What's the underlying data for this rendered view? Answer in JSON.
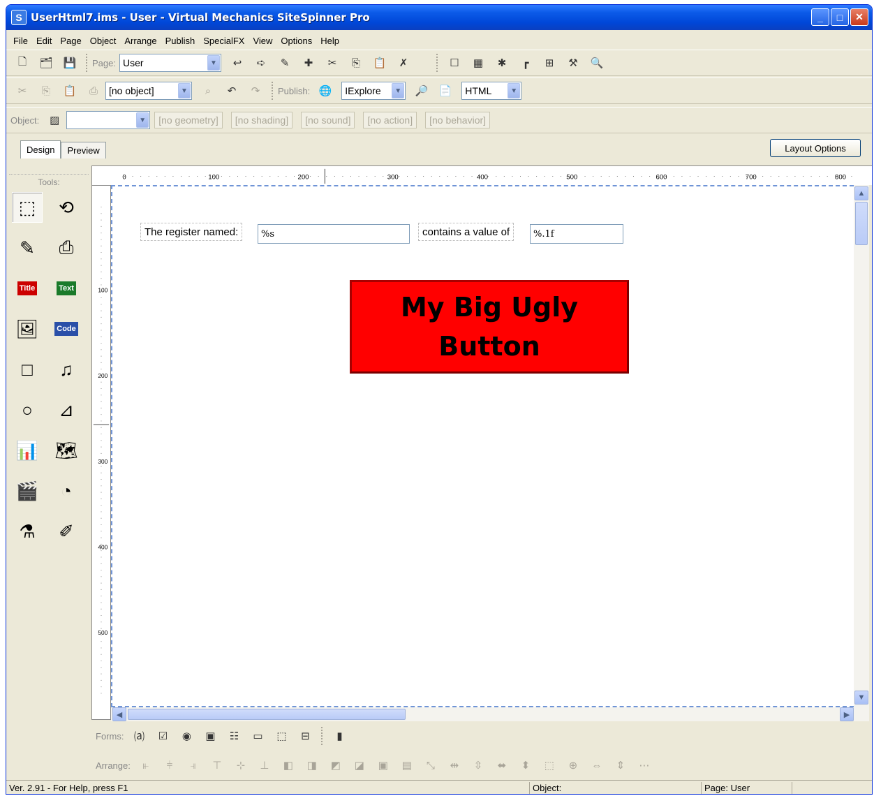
{
  "window": {
    "title": "UserHtml7.ims - User - Virtual Mechanics SiteSpinner Pro"
  },
  "menu": [
    "File",
    "Edit",
    "Page",
    "Object",
    "Arrange",
    "Publish",
    "SpecialFX",
    "View",
    "Options",
    "Help"
  ],
  "toolbar1": {
    "page_label": "Page:",
    "page_value": "User"
  },
  "toolbar2": {
    "object_combo": "[no object]",
    "publish_label": "Publish:",
    "browser": "IExplore",
    "format": "HTML"
  },
  "toolbar3": {
    "object_label": "Object:",
    "object_value": "",
    "fields": [
      "[no geometry]",
      "[no shading]",
      "[no sound]",
      "[no action]",
      "[no behavior]"
    ]
  },
  "tabs": {
    "design": "Design",
    "preview": "Preview"
  },
  "layout_options": "Layout Options",
  "tools_label": "Tools:",
  "ruler": {
    "top": [
      "0",
      "100",
      "200",
      "300",
      "400",
      "500",
      "600",
      "700",
      "800"
    ],
    "left": [
      "100",
      "200",
      "300",
      "400",
      "500"
    ]
  },
  "canvas": {
    "label1": "The register named:",
    "input1": "%s",
    "label2": "contains a value of",
    "input2": "%.1f",
    "button": "My Big Ugly\nButton"
  },
  "forms_label": "Forms:",
  "arrange_label": "Arrange:",
  "status": {
    "left": "Ver. 2.91 - For Help, press F1",
    "object": "Object:",
    "page": "Page: User"
  }
}
